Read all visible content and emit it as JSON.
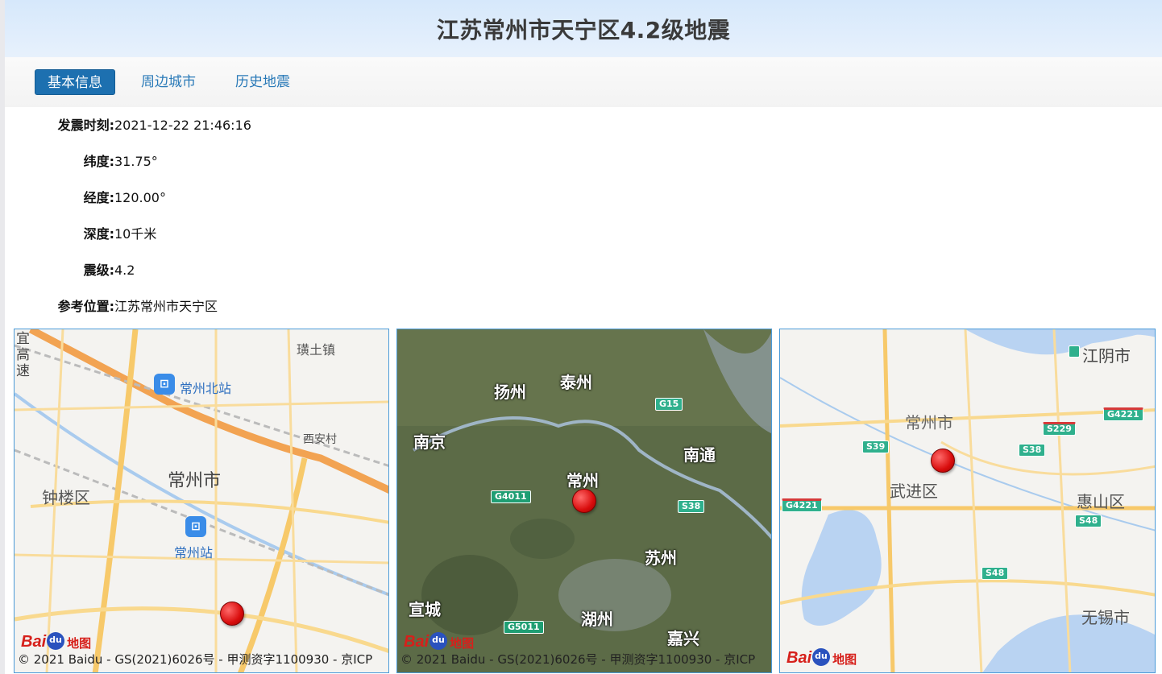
{
  "title": "江苏常州市天宁区4.2级地震",
  "tabs": [
    {
      "label": "基本信息",
      "active": true
    },
    {
      "label": "周边城市",
      "active": false
    },
    {
      "label": "历史地震",
      "active": false
    }
  ],
  "info": [
    {
      "label": "发震时刻:",
      "value": "2021-12-22 21:46:16"
    },
    {
      "label": "纬度:",
      "value": "31.75°"
    },
    {
      "label": "经度:",
      "value": "120.00°"
    },
    {
      "label": "深度:",
      "value": "10千米"
    },
    {
      "label": "震级:",
      "value": "4.2"
    },
    {
      "label": "参考位置:",
      "value": "江苏常州市天宁区"
    }
  ],
  "maps": {
    "map1": {
      "labels": {
        "yigaosu": "宜高速",
        "huangtu": "璜土镇",
        "beizhan": "常州北站",
        "xian": "西安村",
        "city": "常州市",
        "zhonglou": "钟楼区",
        "zhan": "常州站"
      },
      "copyright": "© 2021 Baidu - GS(2021)6026号 - 甲测资字1100930 - 京ICP"
    },
    "map2": {
      "labels": {
        "yangzhou": "扬州",
        "taizhou": "泰州",
        "nanjing": "南京",
        "nantong": "南通",
        "changzhou": "常州",
        "suzhou": "苏州",
        "xuancheng": "宣城",
        "huzhou": "湖州",
        "jiaxing": "嘉兴"
      },
      "shields": {
        "g15": "G15",
        "g4011": "G4011",
        "s38": "S38",
        "g5011": "G5011"
      },
      "copyright": "© 2021 Baidu - GS(2021)6026号 - 甲测资字1100930 - 京ICP"
    },
    "map3": {
      "labels": {
        "jiangyin": "江阴市",
        "changzhou": "常州市",
        "wujin": "武进区",
        "huishan": "惠山区",
        "wuxi": "无锡市"
      },
      "shields": {
        "g4221a": "G4221",
        "s229": "S229",
        "s39": "S39",
        "s38": "S38",
        "g4221b": "G4221",
        "s48a": "S48",
        "s48b": "S48"
      }
    }
  },
  "logo": {
    "b1": "Bai",
    "b2": "地图"
  },
  "colors": {
    "tab_active": "#1d70b0",
    "tab_text": "#2a7ab8",
    "header_bg": "#d6e8fb",
    "pin": "#d90d0d"
  }
}
